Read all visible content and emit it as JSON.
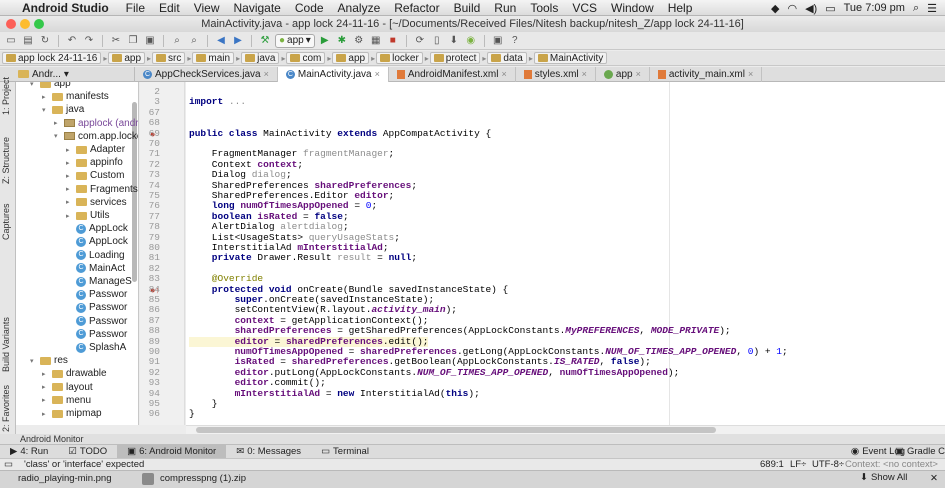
{
  "menubar": {
    "app_name": "Android Studio",
    "items": [
      "File",
      "Edit",
      "View",
      "Navigate",
      "Code",
      "Analyze",
      "Refactor",
      "Build",
      "Run",
      "Tools",
      "VCS",
      "Window",
      "Help"
    ],
    "clock": "Tue 7:09 pm"
  },
  "window": {
    "title": "MainActivity.java - app lock 24-11-16 - [~/Documents/Received Files/Nitesh backup/nitesh_Z/app lock 24-11-16]"
  },
  "toolbar": {
    "run_config": "app"
  },
  "breadcrumb": [
    "app lock 24-11-16",
    "app",
    "src",
    "main",
    "java",
    "com",
    "app",
    "locker",
    "protect",
    "data",
    "MainActivity"
  ],
  "project_combo": "Andr...",
  "tabs": [
    {
      "label": "AppCheckServices.java",
      "kind": "java",
      "active": false
    },
    {
      "label": "MainActivity.java",
      "kind": "java",
      "active": true
    },
    {
      "label": "AndroidManifest.xml",
      "kind": "xml",
      "active": false
    },
    {
      "label": "styles.xml",
      "kind": "xml",
      "active": false
    },
    {
      "label": "app",
      "kind": "app",
      "active": false
    },
    {
      "label": "activity_main.xml",
      "kind": "xml",
      "active": false
    }
  ],
  "side_labels": {
    "project": "1: Project",
    "structure": "Z: Structure",
    "captures": "Captures",
    "build_variants": "Build Variants",
    "favorites": "2: Favorites"
  },
  "tree": [
    {
      "label": "app",
      "kind": "dir",
      "arrow": "▾"
    },
    {
      "label": "manifests",
      "kind": "dir",
      "arrow": "▸"
    },
    {
      "label": "java",
      "kind": "dir",
      "arrow": "▾"
    },
    {
      "label": "applock (android)",
      "kind": "pkg",
      "arrow": "▸"
    },
    {
      "label": "com.app.locker",
      "kind": "pkg",
      "arrow": "▾"
    },
    {
      "label": "Adapter",
      "kind": "dir",
      "arrow": "▸"
    },
    {
      "label": "appinfo",
      "kind": "dir",
      "arrow": "▸"
    },
    {
      "label": "Custom",
      "kind": "dir",
      "arrow": "▸"
    },
    {
      "label": "Fragments",
      "kind": "dir",
      "arrow": "▸"
    },
    {
      "label": "services",
      "kind": "dir",
      "arrow": "▸"
    },
    {
      "label": "Utils",
      "kind": "dir",
      "arrow": "▸"
    },
    {
      "label": "AppLock",
      "kind": "cls",
      "arrow": ""
    },
    {
      "label": "AppLock",
      "kind": "cls",
      "arrow": ""
    },
    {
      "label": "Loading",
      "kind": "cls",
      "arrow": ""
    },
    {
      "label": "MainAct",
      "kind": "cls",
      "arrow": ""
    },
    {
      "label": "ManageS",
      "kind": "cls",
      "arrow": ""
    },
    {
      "label": "Passwor",
      "kind": "cls",
      "arrow": ""
    },
    {
      "label": "Passwor",
      "kind": "cls",
      "arrow": ""
    },
    {
      "label": "Passwor",
      "kind": "cls",
      "arrow": ""
    },
    {
      "label": "Passwor",
      "kind": "cls",
      "arrow": ""
    },
    {
      "label": "SplashA",
      "kind": "cls",
      "arrow": ""
    },
    {
      "label": "res",
      "kind": "dir",
      "arrow": "▾"
    },
    {
      "label": "drawable",
      "kind": "dir",
      "arrow": "▸"
    },
    {
      "label": "layout",
      "kind": "dir",
      "arrow": "▸"
    },
    {
      "label": "menu",
      "kind": "dir",
      "arrow": "▸"
    },
    {
      "label": "mipmap",
      "kind": "dir",
      "arrow": "▸"
    }
  ],
  "line_numbers": [
    "2",
    "3",
    "67",
    "68",
    "69",
    "70",
    "71",
    "72",
    "73",
    "74",
    "75",
    "76",
    "77",
    "78",
    "79",
    "80",
    "81",
    "82",
    "83",
    "84",
    "85",
    "86",
    "87",
    "88",
    "89",
    "90",
    "91",
    "92",
    "93",
    "94",
    "95",
    "96"
  ],
  "code_lines": [
    [
      {
        "t": ""
      }
    ],
    [
      {
        "t": "import ",
        "c": "kw"
      },
      {
        "t": "...",
        "c": "gray"
      }
    ],
    [
      {
        "t": ""
      }
    ],
    [
      {
        "t": ""
      }
    ],
    [
      {
        "t": "public class ",
        "c": "kw"
      },
      {
        "t": "MainActivity "
      },
      {
        "t": "extends ",
        "c": "kw"
      },
      {
        "t": "AppCompatActivity {"
      }
    ],
    [
      {
        "t": ""
      }
    ],
    [
      {
        "t": "    FragmentManager "
      },
      {
        "t": "fragmentManager",
        "c": "gray"
      },
      {
        "t": ";"
      }
    ],
    [
      {
        "t": "    Context "
      },
      {
        "t": "context",
        "c": "fld"
      },
      {
        "t": ";"
      }
    ],
    [
      {
        "t": "    Dialog "
      },
      {
        "t": "dialog",
        "c": "gray"
      },
      {
        "t": ";"
      }
    ],
    [
      {
        "t": "    SharedPreferences "
      },
      {
        "t": "sharedPreferences",
        "c": "fld"
      },
      {
        "t": ";"
      }
    ],
    [
      {
        "t": "    SharedPreferences.Editor "
      },
      {
        "t": "editor",
        "c": "fld"
      },
      {
        "t": ";"
      }
    ],
    [
      {
        "t": "    long ",
        "c": "kw"
      },
      {
        "t": "numOfTimesAppOpened",
        "c": "fld"
      },
      {
        "t": " = "
      },
      {
        "t": "0",
        "c": "num"
      },
      {
        "t": ";"
      }
    ],
    [
      {
        "t": "    boolean ",
        "c": "kw"
      },
      {
        "t": "isRated",
        "c": "fld"
      },
      {
        "t": " = "
      },
      {
        "t": "false",
        "c": "kw"
      },
      {
        "t": ";"
      }
    ],
    [
      {
        "t": "    AlertDialog "
      },
      {
        "t": "alertdialog",
        "c": "gray"
      },
      {
        "t": ";"
      }
    ],
    [
      {
        "t": "    List<UsageStats> "
      },
      {
        "t": "queryUsageStats",
        "c": "gray"
      },
      {
        "t": ";"
      }
    ],
    [
      {
        "t": "    InterstitialAd "
      },
      {
        "t": "mInterstitialAd",
        "c": "fld"
      },
      {
        "t": ";"
      }
    ],
    [
      {
        "t": "    private ",
        "c": "kw"
      },
      {
        "t": "Drawer.Result "
      },
      {
        "t": "result",
        "c": "gray"
      },
      {
        "t": " = "
      },
      {
        "t": "null",
        "c": "kw"
      },
      {
        "t": ";"
      }
    ],
    [
      {
        "t": ""
      }
    ],
    [
      {
        "t": "    @Override",
        "c": "ann"
      }
    ],
    [
      {
        "t": "    protected void ",
        "c": "kw"
      },
      {
        "t": "onCreate(Bundle savedInstanceState) {"
      }
    ],
    [
      {
        "t": "        super",
        "c": "kw"
      },
      {
        "t": ".onCreate(savedInstanceState);"
      }
    ],
    [
      {
        "t": "        setContentView(R.layout."
      },
      {
        "t": "activity_main",
        "c": "cst"
      },
      {
        "t": ");"
      }
    ],
    [
      {
        "t": "        context",
        "c": "fld"
      },
      {
        "t": " = getApplicationContext();"
      }
    ],
    [
      {
        "t": "        sharedPreferences",
        "c": "fld"
      },
      {
        "t": " = getSharedPreferences(AppLockConstants."
      },
      {
        "t": "MyPREFERENCES",
        "c": "cst"
      },
      {
        "t": ", "
      },
      {
        "t": "MODE_PRIVATE",
        "c": "cst"
      },
      {
        "t": ");"
      }
    ],
    [
      {
        "t": "        editor",
        "c": "fld"
      },
      {
        "t": " = "
      },
      {
        "t": "sharedPreferences",
        "c": "fld"
      },
      {
        "t": ".edit();"
      }
    ],
    [
      {
        "t": "        numOfTimesAppOpened",
        "c": "fld"
      },
      {
        "t": " = "
      },
      {
        "t": "sharedPreferences",
        "c": "fld"
      },
      {
        "t": ".getLong(AppLockConstants."
      },
      {
        "t": "NUM_OF_TIMES_APP_OPENED",
        "c": "cst"
      },
      {
        "t": ", "
      },
      {
        "t": "0",
        "c": "num"
      },
      {
        "t": ") + "
      },
      {
        "t": "1",
        "c": "num"
      },
      {
        "t": ";"
      }
    ],
    [
      {
        "t": "        isRated",
        "c": "fld"
      },
      {
        "t": " = "
      },
      {
        "t": "sharedPreferences",
        "c": "fld"
      },
      {
        "t": ".getBoolean(AppLockConstants."
      },
      {
        "t": "IS_RATED",
        "c": "cst"
      },
      {
        "t": ", "
      },
      {
        "t": "false",
        "c": "kw"
      },
      {
        "t": ");"
      }
    ],
    [
      {
        "t": "        editor",
        "c": "fld"
      },
      {
        "t": ".putLong(AppLockConstants."
      },
      {
        "t": "NUM_OF_TIMES_APP_OPENED",
        "c": "cst"
      },
      {
        "t": ", "
      },
      {
        "t": "numOfTimesAppOpened",
        "c": "fld"
      },
      {
        "t": ");"
      }
    ],
    [
      {
        "t": "        editor",
        "c": "fld"
      },
      {
        "t": ".commit();"
      }
    ],
    [
      {
        "t": "        mInterstitialAd",
        "c": "fld"
      },
      {
        "t": " = "
      },
      {
        "t": "new ",
        "c": "kw"
      },
      {
        "t": "InterstitialAd("
      },
      {
        "t": "this",
        "c": "kw"
      },
      {
        "t": ");"
      }
    ],
    [
      {
        "t": "    }"
      }
    ],
    [
      {
        "t": "}"
      }
    ]
  ],
  "bottom": {
    "monitor_title": "Android Monitor",
    "tools": [
      {
        "label": "4: Run",
        "icon": "▶",
        "active": false
      },
      {
        "label": "TODO",
        "icon": "☑",
        "active": false
      },
      {
        "label": "6: Android Monitor",
        "icon": "▣",
        "active": true
      },
      {
        "label": "0: Messages",
        "icon": "✉",
        "active": false
      },
      {
        "label": "Terminal",
        "icon": "▭",
        "active": false
      }
    ],
    "event_log": "Event Log",
    "gradle": "Gradle C"
  },
  "status": {
    "message": "'class' or 'interface' expected",
    "position": "689:1",
    "line_sep": "LF÷",
    "encoding": "UTF-8÷",
    "context": "Context: <no context>"
  },
  "dock": {
    "files": [
      "radio_playing-min.png",
      "compresspng (1).zip"
    ],
    "show_all": "Show All"
  }
}
